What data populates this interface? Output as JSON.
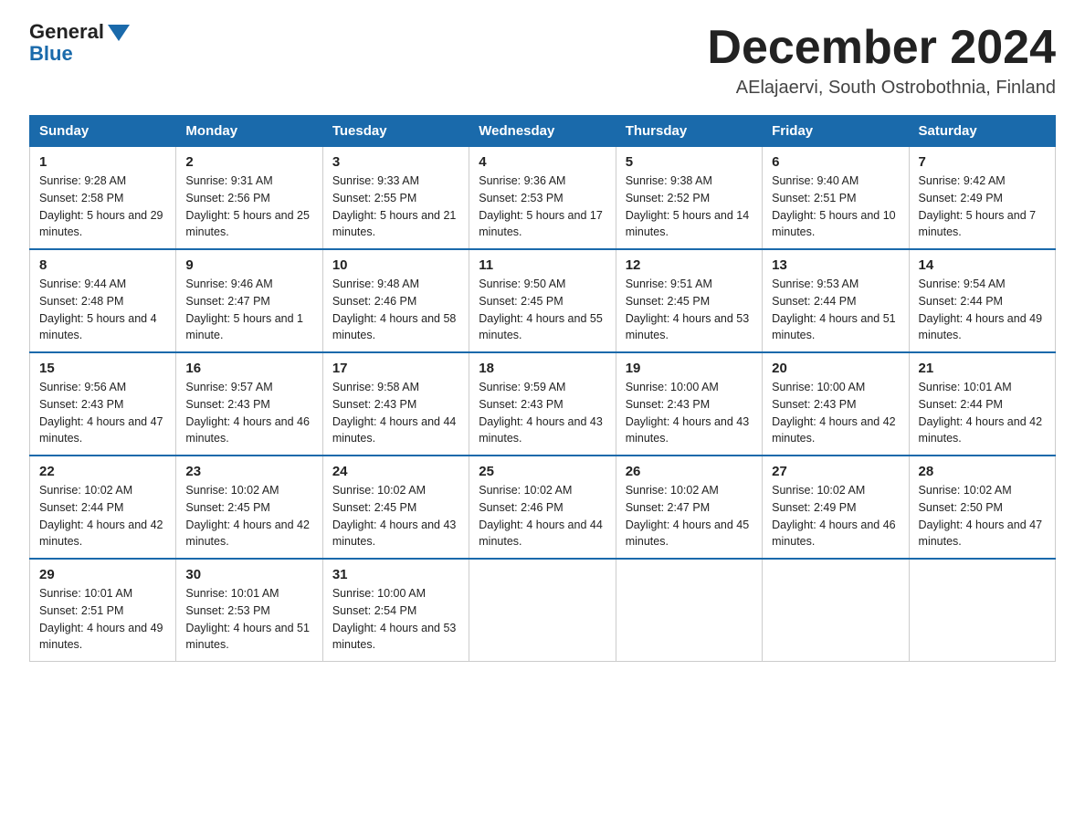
{
  "header": {
    "logo_text": "General",
    "logo_blue": "Blue",
    "month_title": "December 2024",
    "location": "AElajaervi, South Ostrobothnia, Finland"
  },
  "days_of_week": [
    "Sunday",
    "Monday",
    "Tuesday",
    "Wednesday",
    "Thursday",
    "Friday",
    "Saturday"
  ],
  "weeks": [
    [
      {
        "day": "1",
        "sunrise": "9:28 AM",
        "sunset": "2:58 PM",
        "daylight": "5 hours and 29 minutes."
      },
      {
        "day": "2",
        "sunrise": "9:31 AM",
        "sunset": "2:56 PM",
        "daylight": "5 hours and 25 minutes."
      },
      {
        "day": "3",
        "sunrise": "9:33 AM",
        "sunset": "2:55 PM",
        "daylight": "5 hours and 21 minutes."
      },
      {
        "day": "4",
        "sunrise": "9:36 AM",
        "sunset": "2:53 PM",
        "daylight": "5 hours and 17 minutes."
      },
      {
        "day": "5",
        "sunrise": "9:38 AM",
        "sunset": "2:52 PM",
        "daylight": "5 hours and 14 minutes."
      },
      {
        "day": "6",
        "sunrise": "9:40 AM",
        "sunset": "2:51 PM",
        "daylight": "5 hours and 10 minutes."
      },
      {
        "day": "7",
        "sunrise": "9:42 AM",
        "sunset": "2:49 PM",
        "daylight": "5 hours and 7 minutes."
      }
    ],
    [
      {
        "day": "8",
        "sunrise": "9:44 AM",
        "sunset": "2:48 PM",
        "daylight": "5 hours and 4 minutes."
      },
      {
        "day": "9",
        "sunrise": "9:46 AM",
        "sunset": "2:47 PM",
        "daylight": "5 hours and 1 minute."
      },
      {
        "day": "10",
        "sunrise": "9:48 AM",
        "sunset": "2:46 PM",
        "daylight": "4 hours and 58 minutes."
      },
      {
        "day": "11",
        "sunrise": "9:50 AM",
        "sunset": "2:45 PM",
        "daylight": "4 hours and 55 minutes."
      },
      {
        "day": "12",
        "sunrise": "9:51 AM",
        "sunset": "2:45 PM",
        "daylight": "4 hours and 53 minutes."
      },
      {
        "day": "13",
        "sunrise": "9:53 AM",
        "sunset": "2:44 PM",
        "daylight": "4 hours and 51 minutes."
      },
      {
        "day": "14",
        "sunrise": "9:54 AM",
        "sunset": "2:44 PM",
        "daylight": "4 hours and 49 minutes."
      }
    ],
    [
      {
        "day": "15",
        "sunrise": "9:56 AM",
        "sunset": "2:43 PM",
        "daylight": "4 hours and 47 minutes."
      },
      {
        "day": "16",
        "sunrise": "9:57 AM",
        "sunset": "2:43 PM",
        "daylight": "4 hours and 46 minutes."
      },
      {
        "day": "17",
        "sunrise": "9:58 AM",
        "sunset": "2:43 PM",
        "daylight": "4 hours and 44 minutes."
      },
      {
        "day": "18",
        "sunrise": "9:59 AM",
        "sunset": "2:43 PM",
        "daylight": "4 hours and 43 minutes."
      },
      {
        "day": "19",
        "sunrise": "10:00 AM",
        "sunset": "2:43 PM",
        "daylight": "4 hours and 43 minutes."
      },
      {
        "day": "20",
        "sunrise": "10:00 AM",
        "sunset": "2:43 PM",
        "daylight": "4 hours and 42 minutes."
      },
      {
        "day": "21",
        "sunrise": "10:01 AM",
        "sunset": "2:44 PM",
        "daylight": "4 hours and 42 minutes."
      }
    ],
    [
      {
        "day": "22",
        "sunrise": "10:02 AM",
        "sunset": "2:44 PM",
        "daylight": "4 hours and 42 minutes."
      },
      {
        "day": "23",
        "sunrise": "10:02 AM",
        "sunset": "2:45 PM",
        "daylight": "4 hours and 42 minutes."
      },
      {
        "day": "24",
        "sunrise": "10:02 AM",
        "sunset": "2:45 PM",
        "daylight": "4 hours and 43 minutes."
      },
      {
        "day": "25",
        "sunrise": "10:02 AM",
        "sunset": "2:46 PM",
        "daylight": "4 hours and 44 minutes."
      },
      {
        "day": "26",
        "sunrise": "10:02 AM",
        "sunset": "2:47 PM",
        "daylight": "4 hours and 45 minutes."
      },
      {
        "day": "27",
        "sunrise": "10:02 AM",
        "sunset": "2:49 PM",
        "daylight": "4 hours and 46 minutes."
      },
      {
        "day": "28",
        "sunrise": "10:02 AM",
        "sunset": "2:50 PM",
        "daylight": "4 hours and 47 minutes."
      }
    ],
    [
      {
        "day": "29",
        "sunrise": "10:01 AM",
        "sunset": "2:51 PM",
        "daylight": "4 hours and 49 minutes."
      },
      {
        "day": "30",
        "sunrise": "10:01 AM",
        "sunset": "2:53 PM",
        "daylight": "4 hours and 51 minutes."
      },
      {
        "day": "31",
        "sunrise": "10:00 AM",
        "sunset": "2:54 PM",
        "daylight": "4 hours and 53 minutes."
      },
      null,
      null,
      null,
      null
    ]
  ]
}
